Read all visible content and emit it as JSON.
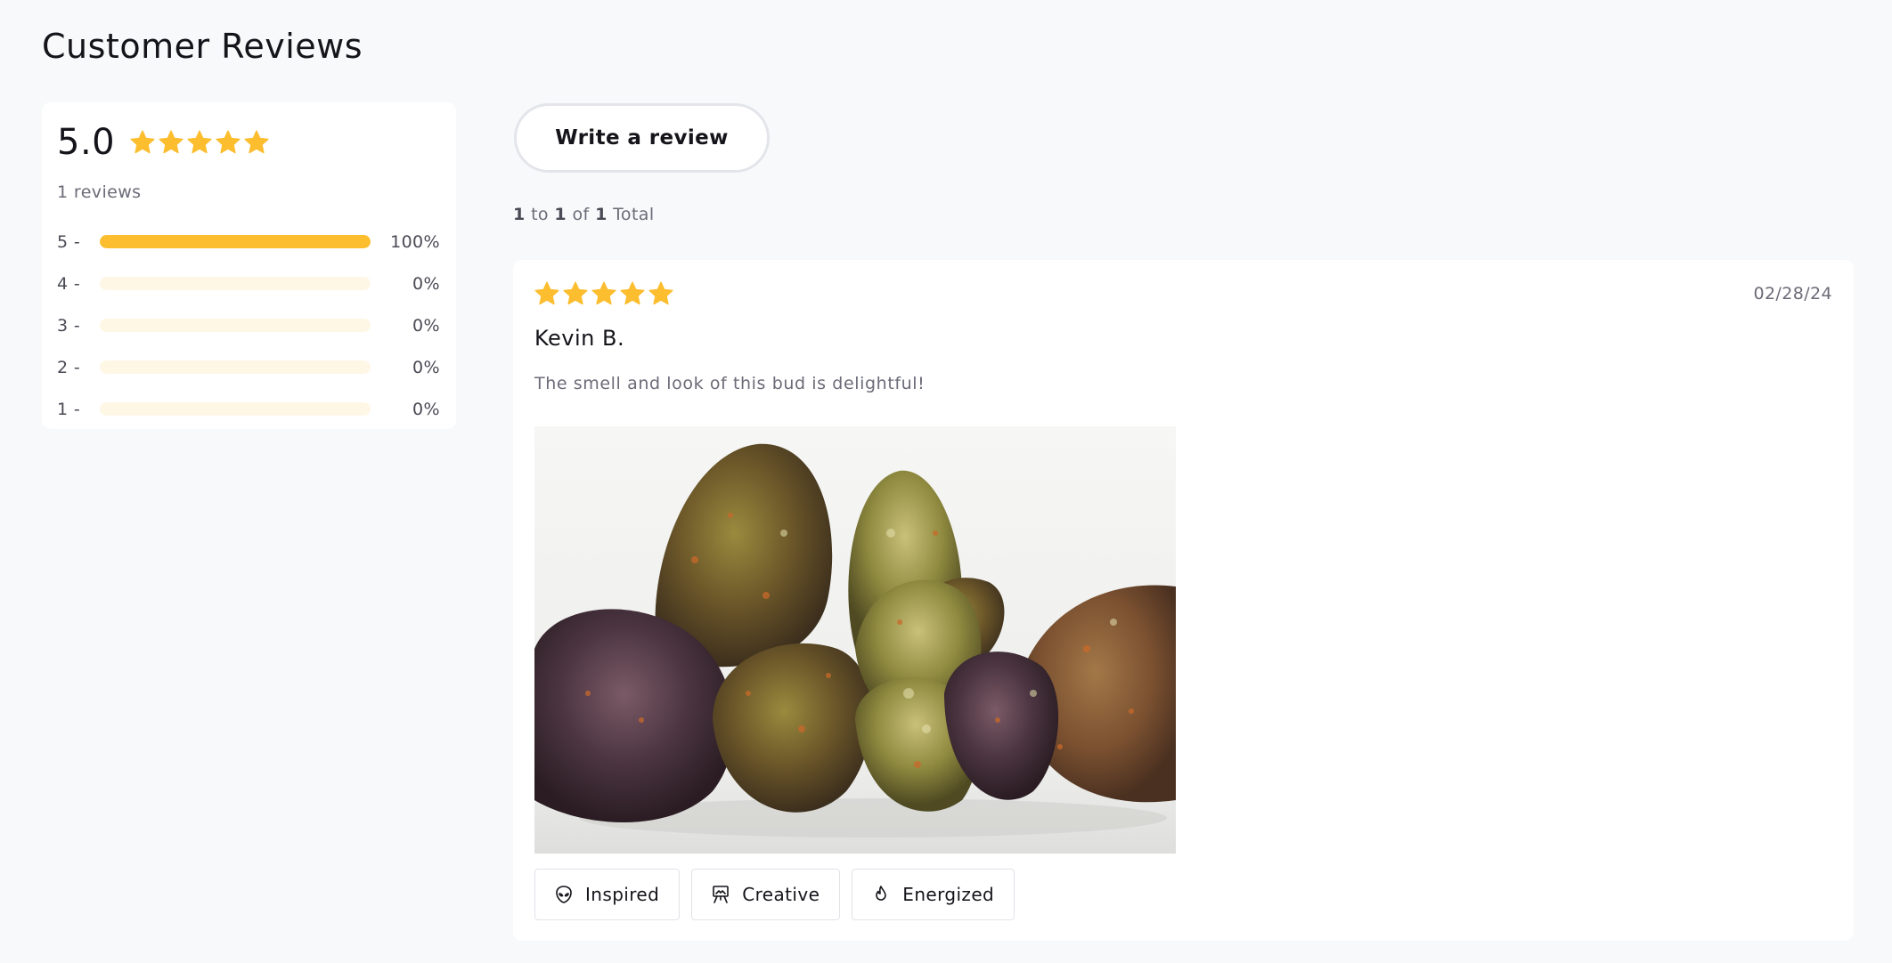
{
  "page": {
    "title": "Customer Reviews"
  },
  "colors": {
    "star": "#fcbd2e",
    "bar_track": "#fff7e6",
    "background": "#f8f9fb"
  },
  "summary": {
    "average": "5.0",
    "average_stars": 5,
    "review_count_text": "1 reviews",
    "distribution": [
      {
        "label": "5 -",
        "fraction": 1.0,
        "percent_text": "100%"
      },
      {
        "label": "4 -",
        "fraction": 0.0,
        "percent_text": "0%"
      },
      {
        "label": "3 -",
        "fraction": 0.0,
        "percent_text": "0%"
      },
      {
        "label": "2 -",
        "fraction": 0.0,
        "percent_text": "0%"
      },
      {
        "label": "1 -",
        "fraction": 0.0,
        "percent_text": "0%"
      }
    ]
  },
  "actions": {
    "write_review_label": "Write a review"
  },
  "pagination": {
    "from": "1",
    "to_word": "to",
    "to": "1",
    "of_word": "of",
    "total": "1",
    "total_word": "Total"
  },
  "reviews": [
    {
      "rating": 5,
      "date": "02/28/24",
      "author": "Kevin B.",
      "body": "The smell and look of this bud is delightful!",
      "photo_icon": "cannabis-buds-photo",
      "tags": [
        {
          "label": "Inspired",
          "icon": "alien-head-icon"
        },
        {
          "label": "Creative",
          "icon": "easel-icon"
        },
        {
          "label": "Energized",
          "icon": "flame-icon"
        }
      ]
    }
  ]
}
